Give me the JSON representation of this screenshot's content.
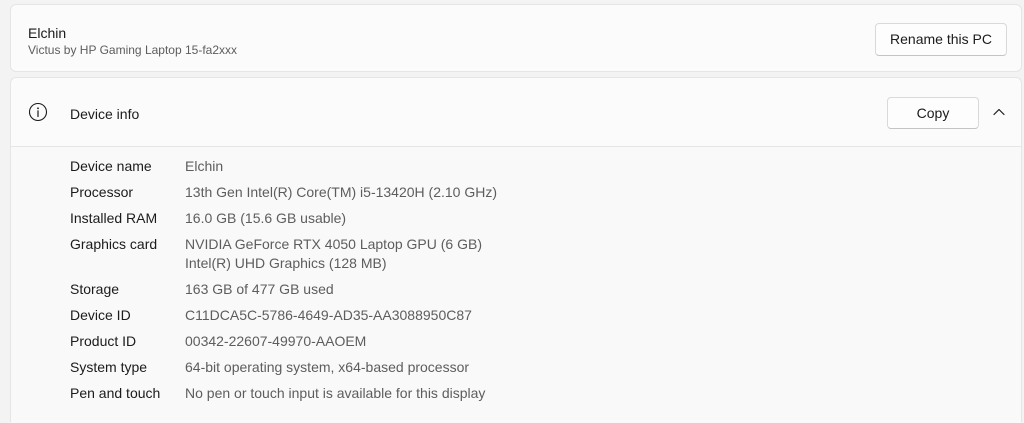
{
  "pc": {
    "name": "Elchin",
    "model": "Victus by HP Gaming Laptop 15-fa2xxx",
    "rename_label": "Rename this PC"
  },
  "device_info": {
    "title": "Device info",
    "copy_label": "Copy",
    "icons": {
      "info": "info-icon",
      "collapse": "chevron-up-icon"
    },
    "specs": [
      {
        "label": "Device name",
        "values": [
          "Elchin"
        ]
      },
      {
        "label": "Processor",
        "values": [
          "13th Gen Intel(R) Core(TM) i5-13420H (2.10 GHz)"
        ]
      },
      {
        "label": "Installed RAM",
        "values": [
          "16.0 GB (15.6 GB usable)"
        ]
      },
      {
        "label": "Graphics card",
        "values": [
          "NVIDIA GeForce RTX 4050 Laptop GPU (6 GB)",
          "Intel(R) UHD Graphics (128 MB)"
        ]
      },
      {
        "label": "Storage",
        "values": [
          "163 GB of 477 GB used"
        ]
      },
      {
        "label": "Device ID",
        "values": [
          "C11DCA5C-5786-4649-AD35-AA3088950C87"
        ]
      },
      {
        "label": "Product ID",
        "values": [
          "00342-22607-49970-AAOEM"
        ]
      },
      {
        "label": "System type",
        "values": [
          "64-bit operating system, x64-based processor"
        ]
      },
      {
        "label": "Pen and touch",
        "values": [
          "No pen or touch input is available for this display"
        ]
      }
    ]
  }
}
